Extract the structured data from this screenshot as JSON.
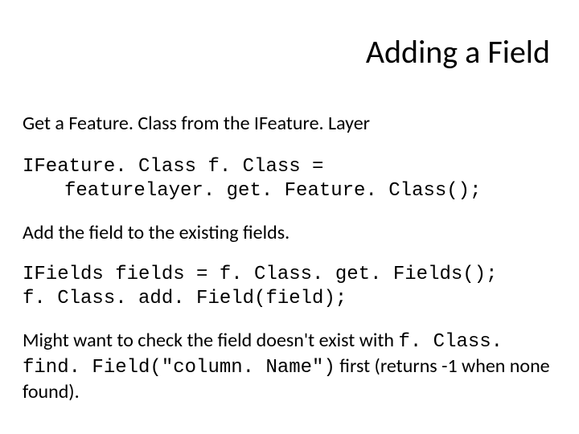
{
  "title": "Adding a Field",
  "p1": "Get a Feature. Class from the IFeature. Layer",
  "code1_line1": "IFeature. Class f. Class =",
  "code1_line2": "featurelayer. get. Feature. Class();",
  "p2": "Add the field to the existing fields.",
  "code2_line1": "IFields fields = f. Class. get. Fields();",
  "code2_line2": "f. Class. add. Field(field);",
  "p3_a": "Might want to check the field doesn't exist with ",
  "p3_code": "f. Class. find. Field(\"column. Name\")",
  "p3_b": "  first (returns -1 when none found)."
}
